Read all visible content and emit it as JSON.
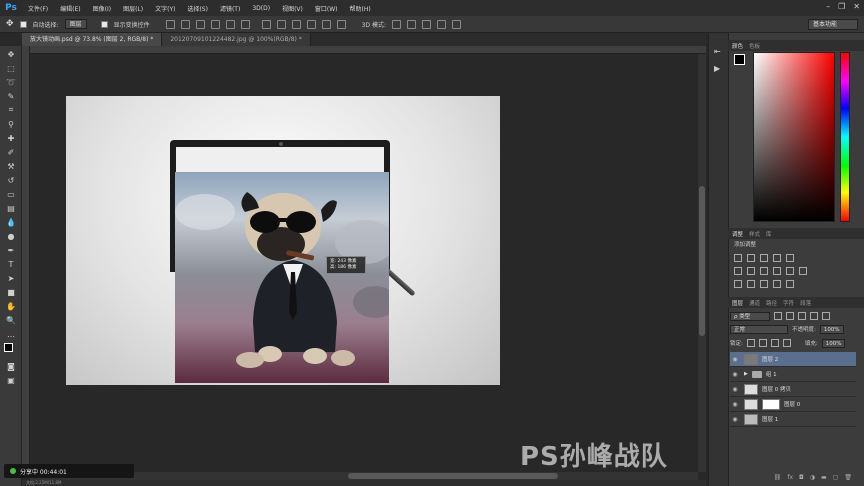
{
  "app": {
    "logo": "Ps"
  },
  "menu": [
    "文件(F)",
    "编辑(E)",
    "图像(I)",
    "图层(L)",
    "文字(Y)",
    "选择(S)",
    "滤镜(T)",
    "3D(D)",
    "视图(V)",
    "窗口(W)",
    "帮助(H)"
  ],
  "options": {
    "auto_select_label": "自动选择:",
    "auto_select_value": "图层",
    "show_transform_label": "显示变换控件",
    "mode_3d_label": "3D 模式:",
    "workspace": "基本功能"
  },
  "tabs": [
    {
      "label": "放大镜动画.psd @ 73.8% (图层 2, RGB/8) *",
      "active": true
    },
    {
      "label": "20120709101224482.jpg @ 100%(RGB/8) *",
      "active": false
    }
  ],
  "canvas": {
    "readout_line1": "宽: 243 像素",
    "readout_line2": "高: 186 像素"
  },
  "status": {
    "text": "文档:2.25M/11.8M"
  },
  "color_panel": {
    "tab1": "颜色",
    "tab2": "色板"
  },
  "adjust_panel": {
    "tab1": "调整",
    "tab2": "样式",
    "tab3": "库",
    "title": "添加调整"
  },
  "layers_panel": {
    "tabs": [
      "图层",
      "通道",
      "路径",
      "字符",
      "段落"
    ],
    "filter_kind": "ρ 类型",
    "blend_mode": "正常",
    "opacity_label": "不透明度:",
    "opacity_value": "100%",
    "lock_label": "锁定:",
    "fill_label": "填充:",
    "fill_value": "100%",
    "layers": [
      {
        "name": "图层 2",
        "selected": true,
        "type": "image"
      },
      {
        "name": "组 1",
        "selected": false,
        "type": "group"
      },
      {
        "name": "图层 0 拷贝",
        "selected": false,
        "type": "image"
      },
      {
        "name": "图层 0",
        "selected": false,
        "type": "masked"
      },
      {
        "name": "图层 1",
        "selected": false,
        "type": "image"
      }
    ]
  },
  "watermark": "PS孙峰战队",
  "share": {
    "label": "分享中 00:44:01"
  }
}
